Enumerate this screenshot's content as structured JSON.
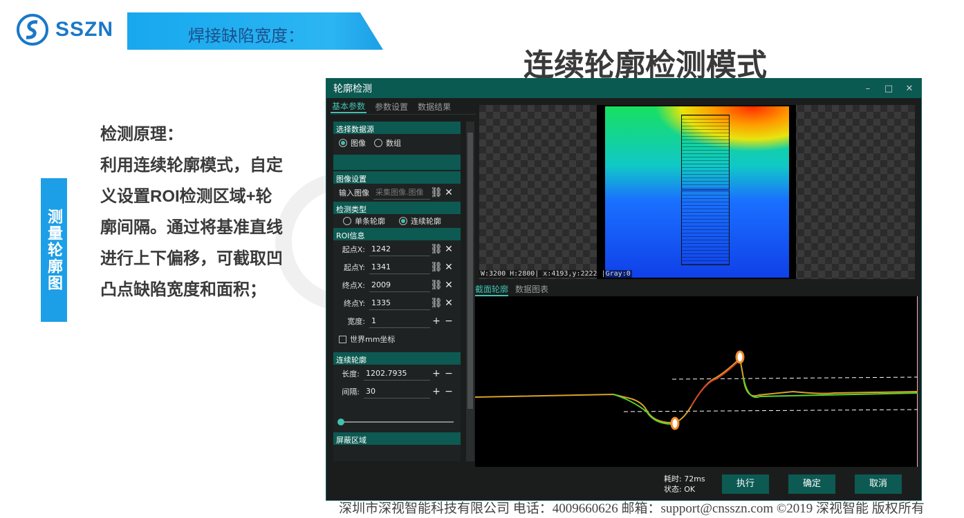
{
  "header": {
    "logo_text": "SSZN",
    "topic": "焊接缺陷宽度：",
    "title": "连续轮廓检测模式"
  },
  "side_tag": "测量轮廓图",
  "principle": {
    "heading": "检测原理：",
    "lines": [
      "利用连续轮廓模式，自定",
      "义设置ROI检测区域+轮",
      "廓间隔。通过将基准直线",
      "进行上下偏移，可截取凹",
      "凸点缺陷宽度和面积；"
    ]
  },
  "footer": "深圳市深视智能科技有限公司  电话：4009660626  邮箱：support@cnsszn.com ©2019 深视智能 版权所有",
  "window": {
    "title": "轮廓检测",
    "controls": {
      "minimize": "–",
      "maximize": "□",
      "close": "✕"
    },
    "tabs": [
      "基本参数",
      "参数设置",
      "数据结果"
    ],
    "sections": {
      "source": {
        "head": "选择数据源",
        "options": [
          {
            "label": "图像",
            "selected": true
          },
          {
            "label": "数组",
            "selected": false
          }
        ]
      },
      "image": {
        "head": "图像设置",
        "input_label": "输入图像",
        "input_placeholder": "采集图像.图像"
      },
      "detect_type": {
        "head": "检测类型",
        "options": [
          {
            "label": "单条轮廓",
            "selected": false
          },
          {
            "label": "连续轮廓",
            "selected": true
          }
        ]
      },
      "roi": {
        "head": "ROI信息",
        "fields": [
          {
            "label": "起点X:",
            "value": "1242"
          },
          {
            "label": "起点Y:",
            "value": "1341"
          },
          {
            "label": "终点X:",
            "value": "2009"
          },
          {
            "label": "终点Y:",
            "value": "1335"
          }
        ],
        "width_label": "宽度:",
        "width_value": "1",
        "world_checkbox": "世界mm坐标"
      },
      "continuous": {
        "head": "连续轮廓",
        "length_label": "长度:",
        "length_value": "1202.7935",
        "interval_label": "间隔:",
        "interval_value": "30",
        "slider_value": 0
      },
      "mask": {
        "head": "屏蔽区域"
      }
    },
    "image_status": "W:3200 H:2800| x:4193,y:2222 |Gray:0",
    "view_tabs": [
      "截面轮廓",
      "数据图表"
    ],
    "stats": {
      "time": "耗时: 72ms",
      "status": "状态: OK"
    },
    "buttons": {
      "execute": "执行",
      "confirm": "确定",
      "cancel": "取消"
    }
  },
  "colors": {
    "accent": "#3fc2b2",
    "window_header": "#0b5a52",
    "brand_blue": "#1c9fe6"
  }
}
